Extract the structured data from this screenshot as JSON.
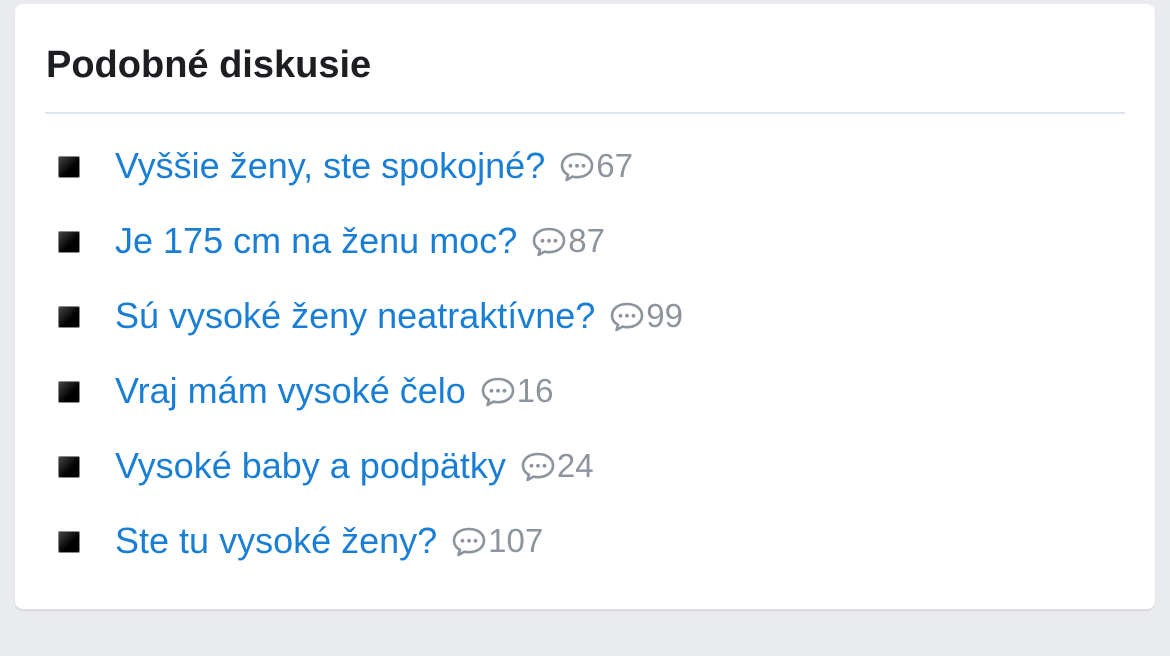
{
  "widget": {
    "title": "Podobné diskusie",
    "items": [
      {
        "title": "Vyššie ženy, ste spokojné?",
        "comments": "67"
      },
      {
        "title": "Je 175 cm na ženu moc?",
        "comments": "87"
      },
      {
        "title": "Sú vysoké ženy neatraktívne?",
        "comments": "99"
      },
      {
        "title": "Vraj mám vysoké čelo",
        "comments": "16"
      },
      {
        "title": "Vysoké baby a podpätky",
        "comments": "24"
      },
      {
        "title": "Ste tu vysoké ženy?",
        "comments": "107"
      }
    ]
  },
  "icons": {
    "bullet": "black-square-bullet-icon",
    "comment": "comment-bubble-icon"
  },
  "colors": {
    "link": "#1a7fd4",
    "meta": "#8d949e",
    "title": "#1c1e21",
    "background": "#e9ebee",
    "card": "#ffffff"
  }
}
